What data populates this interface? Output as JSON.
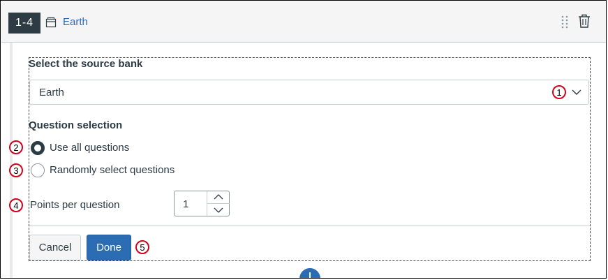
{
  "header": {
    "range": "1-4",
    "bank_name": "Earth"
  },
  "form": {
    "bank_label": "Select the source bank",
    "bank_selected": "Earth",
    "selection_label": "Question selection",
    "radio_all": "Use all questions",
    "radio_random": "Randomly select questions",
    "radio_all_checked": true,
    "points_label": "Points per question",
    "points_value": "1"
  },
  "buttons": {
    "cancel": "Cancel",
    "done": "Done"
  },
  "markers": [
    "1",
    "2",
    "3",
    "4",
    "5"
  ],
  "colors": {
    "accent": "#2b6cb3",
    "dark": "#2d3b45",
    "marker": "#d0021b"
  }
}
